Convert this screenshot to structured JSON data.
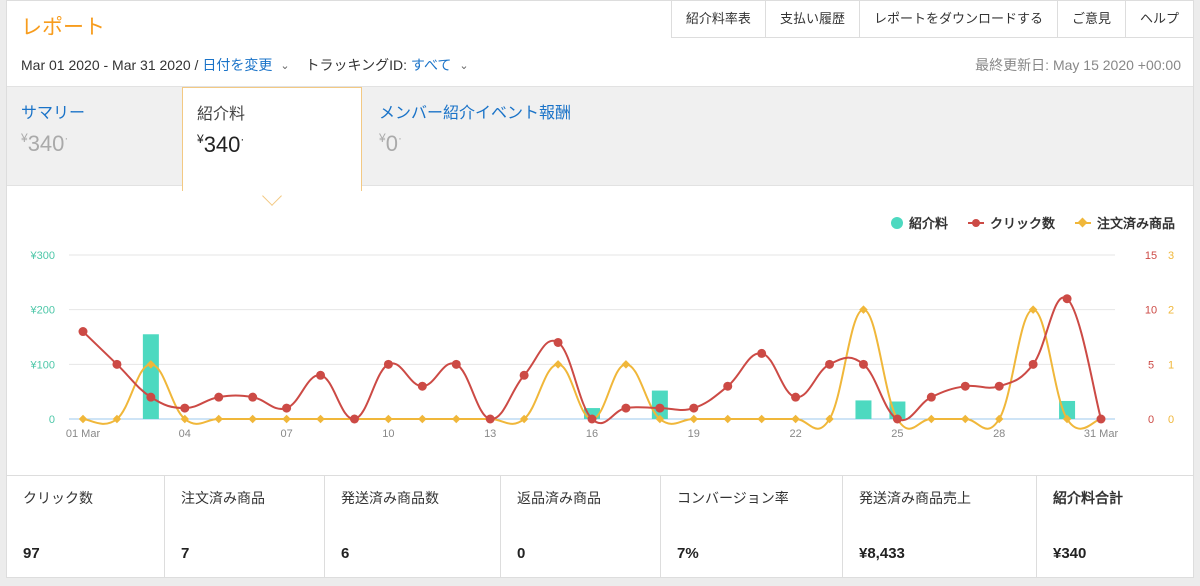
{
  "header": {
    "title": "レポート",
    "links": [
      "紹介料率表",
      "支払い履歴",
      "レポートをダウンロードする",
      "ご意見",
      "ヘルプ"
    ]
  },
  "filters": {
    "date_range": "Mar 01 2020 - Mar 31 2020 /",
    "change_date": "日付を変更",
    "tracking_label": "トラッキングID:",
    "tracking_value": "すべて",
    "last_updated": "最終更新日: May 15 2020 +00:00"
  },
  "tabs": [
    {
      "label": "サマリー",
      "value": "340"
    },
    {
      "label": "紹介料",
      "value": "340"
    },
    {
      "label": "メンバー紹介イベント報酬",
      "value": "0"
    }
  ],
  "currency_symbol": "¥",
  "legend": {
    "fees": "紹介料",
    "clicks": "クリック数",
    "orders": "注文済み商品"
  },
  "colors": {
    "fees": "#4dd9c0",
    "clicks": "#cc4a45",
    "orders": "#f0b73a"
  },
  "chart_data": {
    "type": "bar",
    "x": [
      "01 Mar",
      "02",
      "03",
      "04",
      "05",
      "06",
      "07",
      "08",
      "09",
      "10",
      "11",
      "12",
      "13",
      "14",
      "15",
      "16",
      "17",
      "18",
      "19",
      "20",
      "21",
      "22",
      "23",
      "24",
      "25",
      "26",
      "27",
      "28",
      "29",
      "30",
      "31 Mar"
    ],
    "xtick_labels": [
      "01 Mar",
      "04",
      "07",
      "10",
      "13",
      "16",
      "19",
      "22",
      "25",
      "28",
      "31 Mar"
    ],
    "series": [
      {
        "name": "紹介料",
        "type": "bar",
        "axis": "left",
        "values": [
          0,
          0,
          155,
          0,
          0,
          0,
          0,
          0,
          0,
          0,
          0,
          0,
          0,
          0,
          0,
          20,
          0,
          52,
          0,
          0,
          0,
          0,
          0,
          34,
          32,
          0,
          0,
          0,
          0,
          33,
          0
        ]
      },
      {
        "name": "クリック数",
        "type": "line",
        "axis": "right1",
        "values": [
          8,
          5,
          2,
          1,
          2,
          2,
          1,
          4,
          0,
          5,
          3,
          5,
          0,
          4,
          7,
          0,
          1,
          1,
          1,
          3,
          6,
          2,
          5,
          5,
          0,
          2,
          3,
          3,
          5,
          11,
          0
        ]
      },
      {
        "name": "注文済み商品",
        "type": "line",
        "axis": "right2",
        "values": [
          0,
          0,
          1,
          0,
          0,
          0,
          0,
          0,
          0,
          0,
          0,
          0,
          0,
          0,
          1,
          0,
          1,
          0,
          0,
          0,
          0,
          0,
          0,
          2,
          0,
          0,
          0,
          0,
          2,
          0,
          0
        ]
      }
    ],
    "axes": {
      "left": {
        "ticks": [
          "¥300",
          "¥200",
          "¥100",
          "0"
        ],
        "ylim": [
          0,
          300
        ]
      },
      "right1": {
        "ticks": [
          "15",
          "10",
          "5",
          "0"
        ],
        "ylim": [
          0,
          15
        ]
      },
      "right2": {
        "ticks": [
          "3",
          "2",
          "1",
          "0"
        ],
        "ylim": [
          0,
          3
        ]
      }
    },
    "grid": true,
    "legend_position": "top-right"
  },
  "stats": [
    {
      "label": "クリック数",
      "value": "97"
    },
    {
      "label": "注文済み商品",
      "value": "7"
    },
    {
      "label": "発送済み商品数",
      "value": "6"
    },
    {
      "label": "返品済み商品",
      "value": "0"
    },
    {
      "label": "コンバージョン率",
      "value": "7%"
    },
    {
      "label": "発送済み商品売上",
      "value": "¥8,433"
    },
    {
      "label": "紹介料合計",
      "value": "¥340"
    }
  ]
}
